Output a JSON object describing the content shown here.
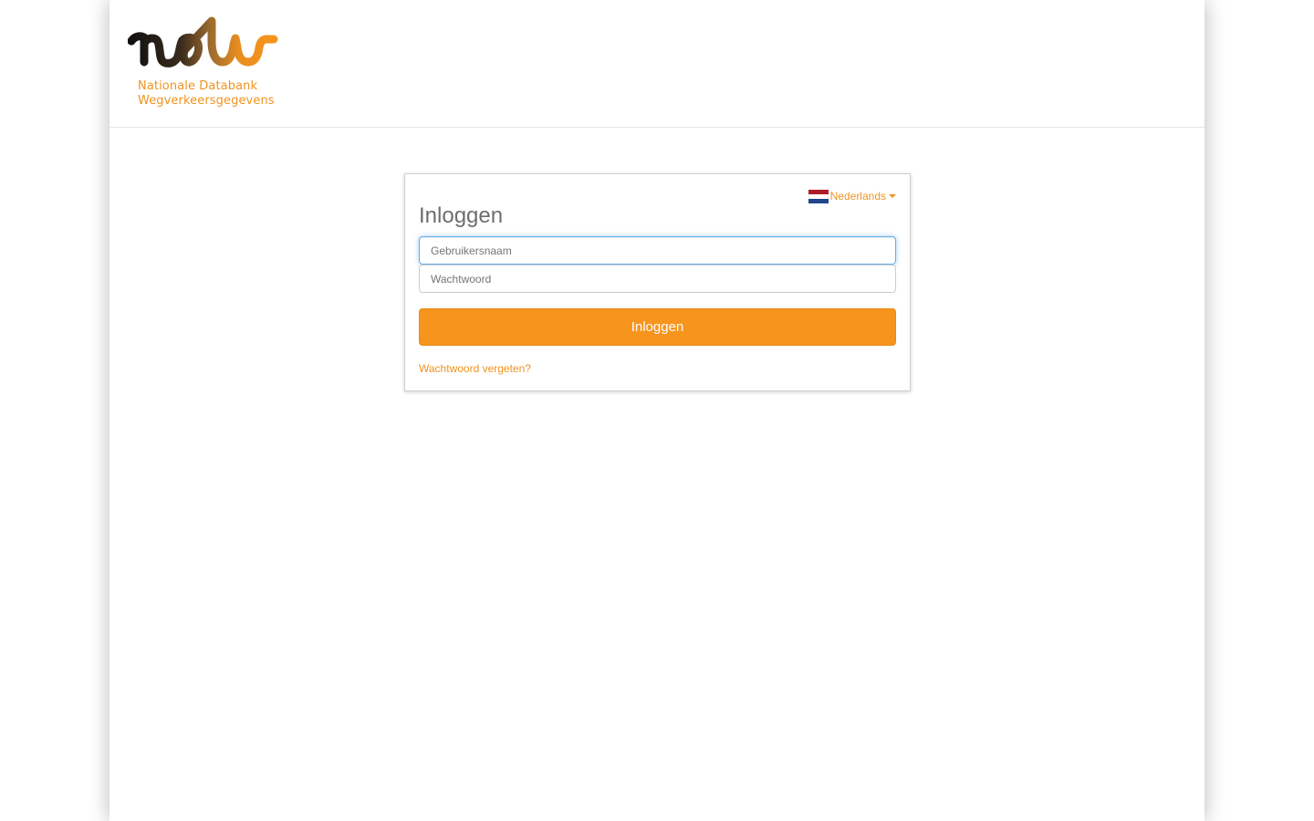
{
  "header": {
    "logo": {
      "wordmark": "ndw",
      "line1": "Nationale Databank",
      "line2": "Wegverkeersgegevens"
    }
  },
  "login": {
    "language": {
      "label": "Nederlands",
      "flag": "nl-flag-icon",
      "flag_colors": [
        "#ae1c28",
        "#ffffff",
        "#21468b"
      ]
    },
    "title": "Inloggen",
    "username": {
      "placeholder": "Gebruikersnaam",
      "value": ""
    },
    "password": {
      "placeholder": "Wachtwoord",
      "value": ""
    },
    "submit_label": "Inloggen",
    "forgot_label": "Wachtwoord vergeten?"
  },
  "colors": {
    "accent": "#f7941d",
    "link": "#f0931f",
    "title": "#6e6e6e"
  }
}
